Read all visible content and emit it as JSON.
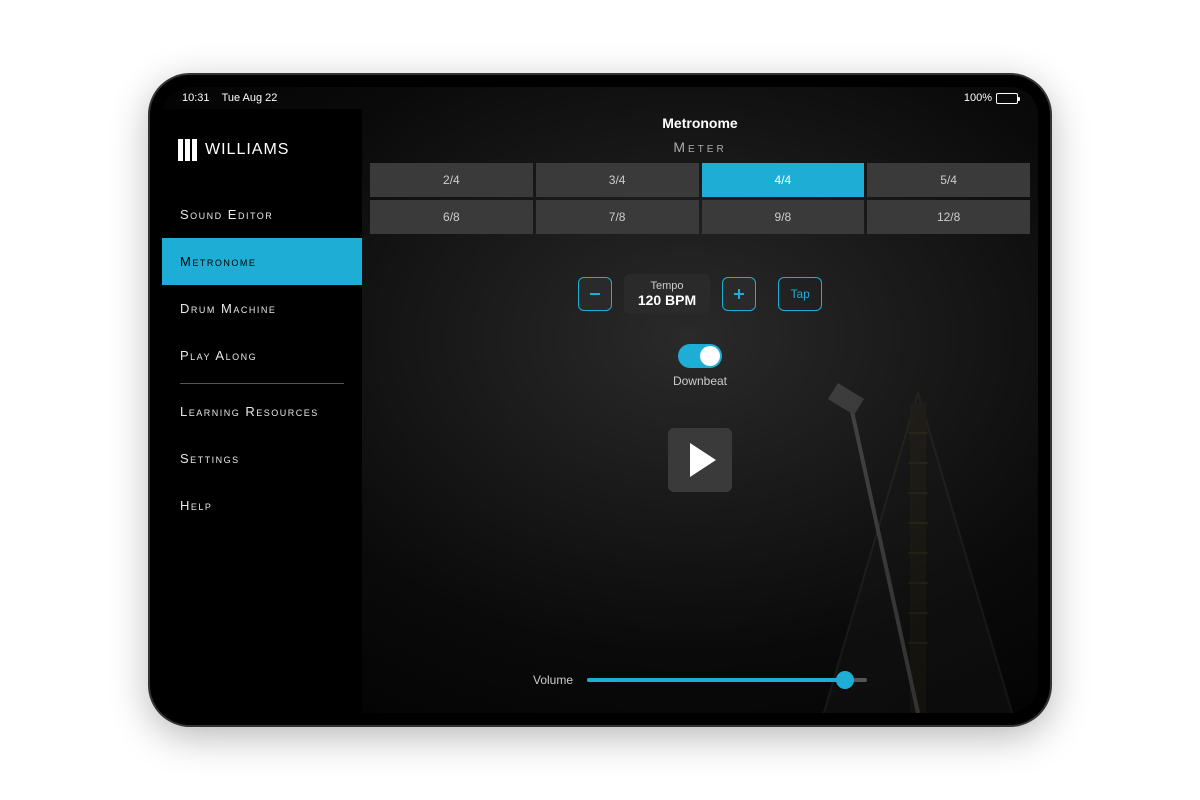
{
  "status": {
    "time": "10:31",
    "date": "Tue Aug 22",
    "battery": "100%"
  },
  "brand": "WILLIAMS",
  "sidebar": {
    "items": [
      {
        "label": "Sound Editor"
      },
      {
        "label": "Metronome"
      },
      {
        "label": "Drum Machine"
      },
      {
        "label": "Play Along"
      },
      {
        "label": "Learning Resources"
      },
      {
        "label": "Settings"
      },
      {
        "label": "Help"
      }
    ],
    "active_index": 1,
    "divider_after_index": 3
  },
  "page": {
    "title": "Metronome",
    "meter_label": "Meter",
    "meters": [
      "2/4",
      "3/4",
      "4/4",
      "5/4",
      "6/8",
      "7/8",
      "9/8",
      "12/8"
    ],
    "meter_selected": "4/4",
    "tempo": {
      "label": "Tempo",
      "value": "120 BPM",
      "tap_label": "Tap"
    },
    "downbeat": {
      "label": "Downbeat",
      "on": true
    },
    "volume": {
      "label": "Volume",
      "percent": 92
    }
  },
  "colors": {
    "accent": "#1eaed5"
  }
}
